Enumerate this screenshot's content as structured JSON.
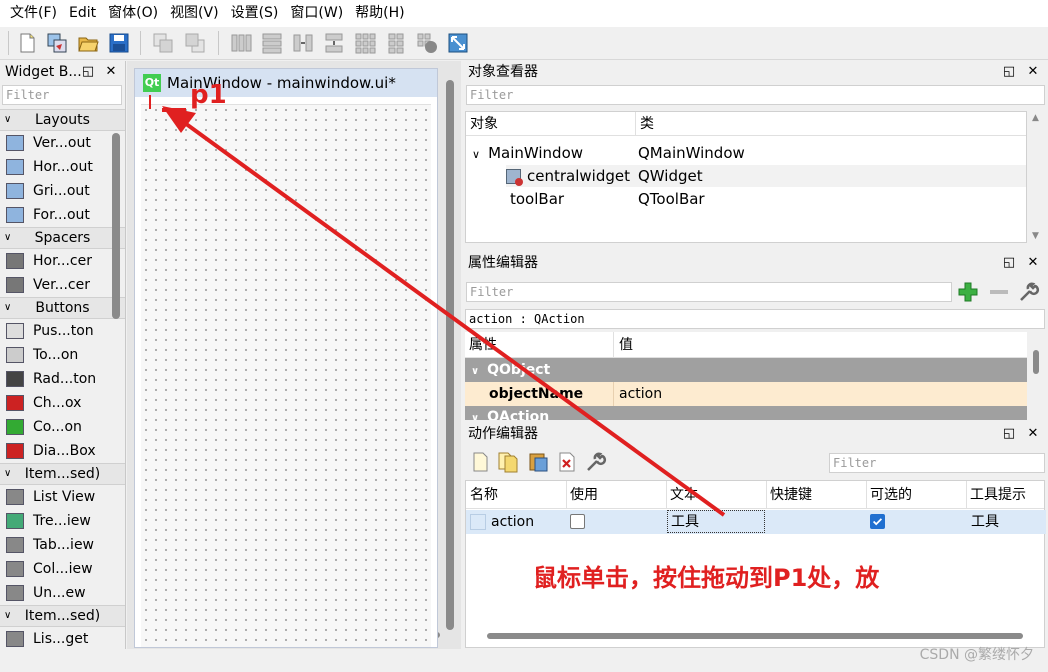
{
  "menu": [
    "文件(F)",
    "Edit",
    "窗体(O)",
    "视图(V)",
    "设置(S)",
    "窗口(W)",
    "帮助(H)"
  ],
  "widget_box": {
    "title": "Widget B...",
    "filter_placeholder": "Filter",
    "categories": [
      {
        "name": "Layouts",
        "items": [
          "Ver...out",
          "Hor...out",
          "Gri...out",
          "For...out"
        ]
      },
      {
        "name": "Spacers",
        "items": [
          "Hor...cer",
          "Ver...cer"
        ]
      },
      {
        "name": "Buttons",
        "items": [
          "Pus...ton",
          "To...on",
          "Rad...ton",
          "Ch...ox",
          "Co...on",
          "Dia...Box"
        ]
      },
      {
        "name": "Item...sed)",
        "items": [
          "List View",
          "Tre...iew",
          "Tab...iew",
          "Col...iew",
          "Un...ew"
        ]
      },
      {
        "name": "Item...sed)",
        "items": [
          "Lis...get"
        ]
      }
    ]
  },
  "form": {
    "title": "MainWindow - mainwindow.ui*"
  },
  "object_inspector": {
    "title": "对象查看器",
    "filter_placeholder": "Filter",
    "col_object": "对象",
    "col_class": "类",
    "rows": [
      {
        "object": "MainWindow",
        "class": "QMainWindow"
      },
      {
        "object": "centralwidget",
        "class": "QWidget"
      },
      {
        "object": "toolBar",
        "class": "QToolBar"
      }
    ]
  },
  "property_editor": {
    "title": "属性编辑器",
    "filter_placeholder": "Filter",
    "context": "action : QAction",
    "col_property": "属性",
    "col_value": "值",
    "group_qobject": "QObject",
    "prop_name": "objectName",
    "prop_value": "action",
    "group_next": "QAction"
  },
  "action_editor": {
    "title": "动作编辑器",
    "filter_placeholder": "Filter",
    "columns": [
      "名称",
      "使用",
      "文本",
      "快捷键",
      "可选的",
      "工具提示"
    ],
    "row": {
      "name": "action",
      "used": false,
      "text": "工具",
      "shortcut": "",
      "checkable": true,
      "tooltip": "工具"
    }
  },
  "annotation": {
    "label": "p1",
    "text": "鼠标单击，按住拖动到P1处，放",
    "color": "#e02020"
  },
  "watermark": "CSDN @繁缕怀夕"
}
